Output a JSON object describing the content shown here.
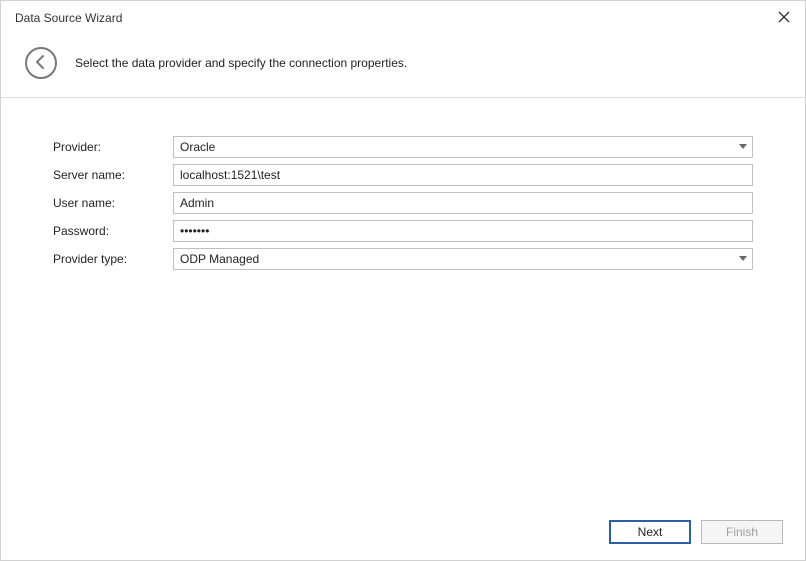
{
  "window": {
    "title": "Data Source Wizard"
  },
  "header": {
    "description": "Select the data provider and specify the connection properties."
  },
  "form": {
    "provider": {
      "label": "Provider:",
      "value": "Oracle"
    },
    "server": {
      "label": "Server name:",
      "value": "localhost:1521\\test"
    },
    "user": {
      "label": "User name:",
      "value": "Admin"
    },
    "password": {
      "label": "Password:",
      "value": "•••••••"
    },
    "provider_type": {
      "label": "Provider type:",
      "value": "ODP Managed"
    }
  },
  "footer": {
    "next": "Next",
    "finish": "Finish"
  }
}
